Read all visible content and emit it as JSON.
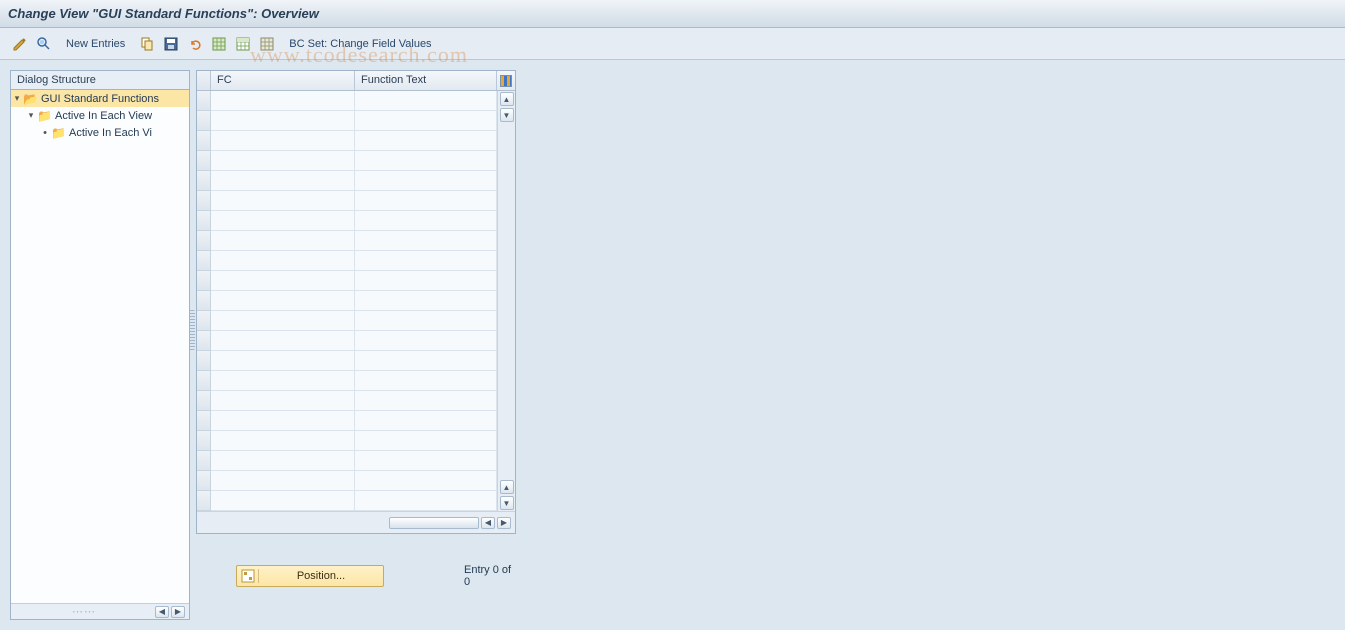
{
  "title": "Change View \"GUI Standard Functions\": Overview",
  "toolbar": {
    "new_entries": "New Entries",
    "bc_set": "BC Set: Change Field Values"
  },
  "tree": {
    "header": "Dialog Structure",
    "node1": "GUI Standard Functions",
    "node2": "Active In Each View",
    "node3": "Active In Each Vi"
  },
  "table": {
    "col_fc": "FC",
    "col_ftext": "Function Text"
  },
  "position": {
    "button_label": "Position...",
    "entry_text": "Entry 0 of 0"
  },
  "watermark": "www.tcodesearch.com",
  "icons": {
    "pencil": "✎",
    "glasses": "🔍",
    "copy": "📋",
    "save": "💾",
    "undo": "↶",
    "table1": "▦",
    "table2": "▦",
    "table3": "▦",
    "folder_open": "📂",
    "folder_closed": "📁"
  }
}
